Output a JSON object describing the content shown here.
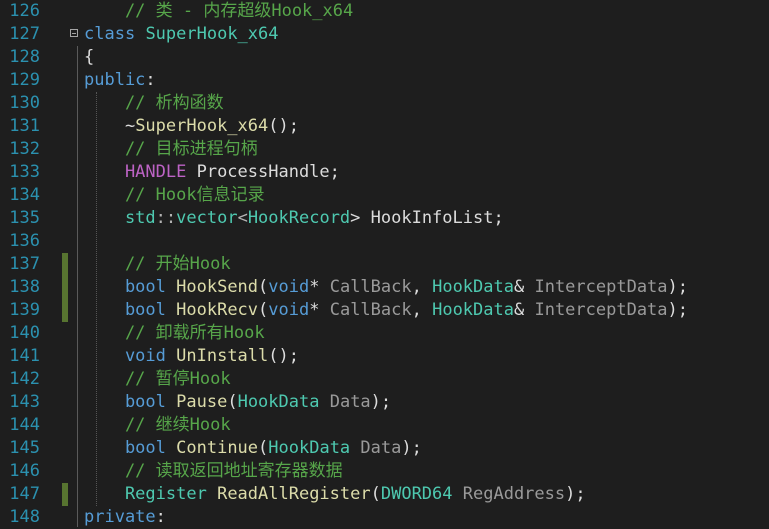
{
  "colors": {
    "background": "#1e1e1e",
    "line_number": "#2b91af",
    "keyword": "#569cd6",
    "comment": "#57a64a",
    "type": "#4ec9b0",
    "function": "#dcdcaa",
    "parameter": "#9a9a9a",
    "text": "#dcdcdc",
    "change_marker": "#577430"
  },
  "lines": [
    {
      "num": "126",
      "tokens": [
        {
          "t": "    // 类 - 内存超级Hook_x64",
          "c": "cm"
        }
      ]
    },
    {
      "num": "127",
      "fold": true,
      "tokens": [
        {
          "t": "class",
          "c": "kw"
        },
        {
          "t": " ",
          "c": "id"
        },
        {
          "t": "SuperHook_x64",
          "c": "ty"
        }
      ]
    },
    {
      "num": "128",
      "tokens": [
        {
          "t": "{",
          "c": "id"
        }
      ]
    },
    {
      "num": "129",
      "tokens": [
        {
          "t": "public",
          "c": "kw"
        },
        {
          "t": ":",
          "c": "id"
        }
      ]
    },
    {
      "num": "130",
      "tokens": [
        {
          "t": "    // 析构函数",
          "c": "cm"
        }
      ]
    },
    {
      "num": "131",
      "tokens": [
        {
          "t": "    ~",
          "c": "id"
        },
        {
          "t": "SuperHook_x64",
          "c": "fn"
        },
        {
          "t": "();",
          "c": "id"
        }
      ]
    },
    {
      "num": "132",
      "tokens": [
        {
          "t": "    // 目标进程句柄",
          "c": "cm"
        }
      ]
    },
    {
      "num": "133",
      "tokens": [
        {
          "t": "    HANDLE",
          "c": "mac"
        },
        {
          "t": " ProcessHandle;",
          "c": "id"
        }
      ]
    },
    {
      "num": "134",
      "tokens": [
        {
          "t": "    // Hook信息记录",
          "c": "cm"
        }
      ]
    },
    {
      "num": "135",
      "tokens": [
        {
          "t": "    std",
          "c": "ty"
        },
        {
          "t": "::",
          "c": "op"
        },
        {
          "t": "vector",
          "c": "ty"
        },
        {
          "t": "<",
          "c": "op"
        },
        {
          "t": "HookRecord",
          "c": "ty"
        },
        {
          "t": "> HookInfoList;",
          "c": "id"
        }
      ]
    },
    {
      "num": "136",
      "tokens": []
    },
    {
      "num": "137",
      "marker": true,
      "tokens": [
        {
          "t": "    // 开始Hook",
          "c": "cm"
        }
      ]
    },
    {
      "num": "138",
      "marker": true,
      "tokens": [
        {
          "t": "    bool",
          "c": "kw"
        },
        {
          "t": " ",
          "c": "id"
        },
        {
          "t": "HookSend",
          "c": "fn"
        },
        {
          "t": "(",
          "c": "id"
        },
        {
          "t": "void",
          "c": "kw"
        },
        {
          "t": "* ",
          "c": "id"
        },
        {
          "t": "CallBack",
          "c": "pn"
        },
        {
          "t": ", ",
          "c": "id"
        },
        {
          "t": "HookData",
          "c": "ty"
        },
        {
          "t": "& ",
          "c": "id"
        },
        {
          "t": "InterceptData",
          "c": "pn"
        },
        {
          "t": ");",
          "c": "id"
        }
      ]
    },
    {
      "num": "139",
      "marker": true,
      "tokens": [
        {
          "t": "    bool",
          "c": "kw"
        },
        {
          "t": " ",
          "c": "id"
        },
        {
          "t": "HookRecv",
          "c": "fn"
        },
        {
          "t": "(",
          "c": "id"
        },
        {
          "t": "void",
          "c": "kw"
        },
        {
          "t": "* ",
          "c": "id"
        },
        {
          "t": "CallBack",
          "c": "pn"
        },
        {
          "t": ", ",
          "c": "id"
        },
        {
          "t": "HookData",
          "c": "ty"
        },
        {
          "t": "& ",
          "c": "id"
        },
        {
          "t": "InterceptData",
          "c": "pn"
        },
        {
          "t": ");",
          "c": "id"
        }
      ]
    },
    {
      "num": "140",
      "tokens": [
        {
          "t": "    // 卸载所有Hook",
          "c": "cm"
        }
      ]
    },
    {
      "num": "141",
      "tokens": [
        {
          "t": "    void",
          "c": "kw"
        },
        {
          "t": " ",
          "c": "id"
        },
        {
          "t": "UnInstall",
          "c": "fn"
        },
        {
          "t": "();",
          "c": "id"
        }
      ]
    },
    {
      "num": "142",
      "tokens": [
        {
          "t": "    // 暂停Hook",
          "c": "cm"
        }
      ]
    },
    {
      "num": "143",
      "tokens": [
        {
          "t": "    bool",
          "c": "kw"
        },
        {
          "t": " ",
          "c": "id"
        },
        {
          "t": "Pause",
          "c": "fn"
        },
        {
          "t": "(",
          "c": "id"
        },
        {
          "t": "HookData",
          "c": "ty"
        },
        {
          "t": " ",
          "c": "id"
        },
        {
          "t": "Data",
          "c": "pn"
        },
        {
          "t": ");",
          "c": "id"
        }
      ]
    },
    {
      "num": "144",
      "tokens": [
        {
          "t": "    // 继续Hook",
          "c": "cm"
        }
      ]
    },
    {
      "num": "145",
      "tokens": [
        {
          "t": "    bool",
          "c": "kw"
        },
        {
          "t": " ",
          "c": "id"
        },
        {
          "t": "Continue",
          "c": "fn"
        },
        {
          "t": "(",
          "c": "id"
        },
        {
          "t": "HookData",
          "c": "ty"
        },
        {
          "t": " ",
          "c": "id"
        },
        {
          "t": "Data",
          "c": "pn"
        },
        {
          "t": ");",
          "c": "id"
        }
      ]
    },
    {
      "num": "146",
      "tokens": [
        {
          "t": "    // 读取返回地址寄存器数据",
          "c": "cm"
        }
      ]
    },
    {
      "num": "147",
      "marker": true,
      "tokens": [
        {
          "t": "    Register",
          "c": "ty"
        },
        {
          "t": " ",
          "c": "id"
        },
        {
          "t": "ReadAllRegister",
          "c": "fn"
        },
        {
          "t": "(",
          "c": "id"
        },
        {
          "t": "DWORD64",
          "c": "ty"
        },
        {
          "t": " ",
          "c": "id"
        },
        {
          "t": "RegAddress",
          "c": "pn"
        },
        {
          "t": ");",
          "c": "id"
        }
      ]
    },
    {
      "num": "148",
      "tokens": [
        {
          "t": "private",
          "c": "kw"
        },
        {
          "t": ":",
          "c": "id"
        }
      ]
    }
  ]
}
